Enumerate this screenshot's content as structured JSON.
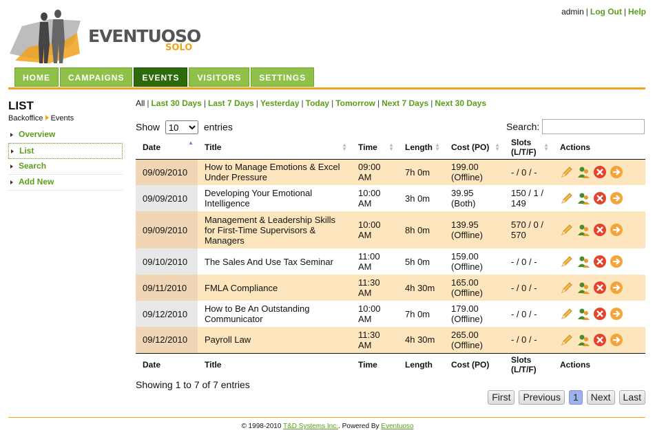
{
  "brand": {
    "name": "EVENTUOSO",
    "sub": "SOLO"
  },
  "top_links": {
    "user": "admin",
    "logout": "Log Out",
    "help": "Help"
  },
  "tabs": [
    {
      "label": "HOME",
      "active": false
    },
    {
      "label": "CAMPAIGNS",
      "active": false
    },
    {
      "label": "EVENTS",
      "active": true
    },
    {
      "label": "VISITORS",
      "active": false
    },
    {
      "label": "SETTINGS",
      "active": false
    }
  ],
  "sidebar": {
    "title": "LIST",
    "breadcrumb": [
      "Backoffice",
      "Events"
    ],
    "items": [
      {
        "label": "Overview",
        "active": false
      },
      {
        "label": "List",
        "active": true
      },
      {
        "label": "Search",
        "active": false
      },
      {
        "label": "Add New",
        "active": false
      }
    ]
  },
  "filters": [
    "All",
    "Last 30 Days",
    "Last 7 Days",
    "Yesterday",
    "Today",
    "Tomorrow",
    "Next 7 Days",
    "Next 30 Days"
  ],
  "length": {
    "prefix": "Show",
    "value": "10",
    "suffix": "entries"
  },
  "search": {
    "label": "Search:",
    "value": ""
  },
  "columns": [
    "Date",
    "Title",
    "Time",
    "Length",
    "Cost (PO)",
    "Slots (L/T/F)",
    "Actions"
  ],
  "rows": [
    {
      "date": "09/09/2010",
      "title": "How to Manage Emotions & Excel Under Pressure",
      "time": "09:00 AM",
      "length": "7h 0m",
      "cost": "199.00 (Offline)",
      "slots": "- / 0 / -"
    },
    {
      "date": "09/09/2010",
      "title": "Developing Your Emotional Intelligence",
      "time": "10:00 AM",
      "length": "3h 0m",
      "cost": "39.95 (Both)",
      "slots": "150 / 1 / 149"
    },
    {
      "date": "09/09/2010",
      "title": "Management & Leadership Skills for First-Time Supervisors & Managers",
      "time": "10:00 AM",
      "length": "8h 0m",
      "cost": "139.95 (Offline)",
      "slots": "570 / 0 / 570"
    },
    {
      "date": "09/10/2010",
      "title": "The Sales And Use Tax Seminar",
      "time": "11:00 AM",
      "length": "5h 0m",
      "cost": "159.00 (Offline)",
      "slots": "- / 0 / -"
    },
    {
      "date": "09/11/2010",
      "title": "FMLA Compliance",
      "time": "11:30 AM",
      "length": "4h 30m",
      "cost": "165.00 (Offline)",
      "slots": "- / 0 / -"
    },
    {
      "date": "09/12/2010",
      "title": "How to Be An Outstanding Communicator",
      "time": "10:00 AM",
      "length": "7h 0m",
      "cost": "179.00 (Offline)",
      "slots": "- / 0 / -"
    },
    {
      "date": "09/12/2010",
      "title": "Payroll Law",
      "time": "11:30 AM",
      "length": "4h 30m",
      "cost": "265.00 (Offline)",
      "slots": "- / 0 / -"
    }
  ],
  "info": "Showing 1 to 7 of 7 entries",
  "pager": {
    "first": "First",
    "previous": "Previous",
    "current": "1",
    "next": "Next",
    "last": "Last"
  },
  "footer": {
    "copy": "© 1998-2010",
    "company": "T&D Systems Inc.",
    "powered": ". Powered By",
    "product": "Eventuoso"
  },
  "colors": {
    "green": "#8ec04a",
    "dark_green": "#2d6a0a",
    "orange": "#f0a21c"
  }
}
